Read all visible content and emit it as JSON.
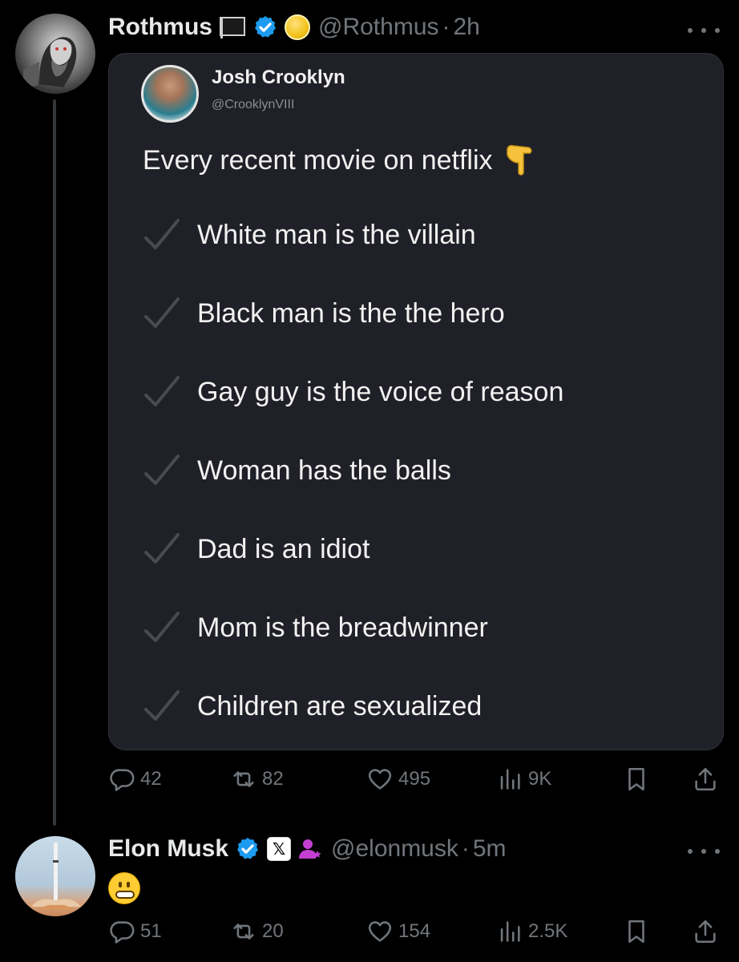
{
  "thread": {
    "original_post": {
      "author_name": "Rothmus",
      "author_handle": "@Rothmus",
      "separator": "·",
      "time": "2h",
      "badges": [
        "flag-icon",
        "verified-icon",
        "coin-icon"
      ],
      "media": {
        "quoted_author_name": "Josh Crooklyn",
        "quoted_author_handle": "@CrooklynVIII",
        "quoted_text": "Every recent movie on netflix",
        "emoji": "backhand-index-pointing-down",
        "checklist": [
          "White man is the villain",
          "Black man is the the hero",
          "Gay guy is the voice of reason",
          "Woman has the balls",
          "Dad is an idiot",
          "Mom is the breadwinner",
          "Children are sexualized"
        ]
      },
      "stats": {
        "replies": "42",
        "reposts": "82",
        "likes": "495",
        "views": "9K"
      }
    },
    "reply": {
      "author_name": "Elon Musk",
      "author_handle": "@elonmusk",
      "separator": "·",
      "time": "5m",
      "badges": [
        "verified-icon",
        "x-affiliate-badge",
        "person-icon"
      ],
      "x_badge_label": "𝕏",
      "text_emoji": "grimacing-face",
      "stats": {
        "replies": "51",
        "reposts": "20",
        "likes": "154",
        "views": "2.5K"
      }
    }
  },
  "colors": {
    "background": "#000000",
    "text_primary": "#e7e9ea",
    "text_secondary": "#71767b",
    "verified_blue": "#1d9bf0",
    "card_background": "#202128",
    "thread_line": "#333639"
  }
}
